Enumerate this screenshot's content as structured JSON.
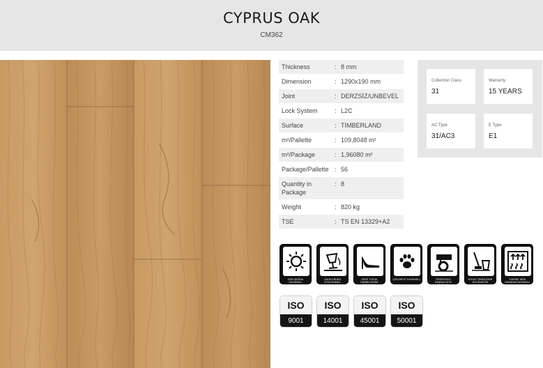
{
  "product": {
    "name": "CYPRUS OAK",
    "code": "CM362"
  },
  "specs": [
    {
      "label": "Thickness",
      "value": "8 mm"
    },
    {
      "label": "Dimension",
      "value": "1290x190 mm"
    },
    {
      "label": "Joint",
      "value": "DERZSİZ/UNBEVEL"
    },
    {
      "label": "Lock System",
      "value": "L2C"
    },
    {
      "label": "Surface",
      "value": "TIMBERLAND"
    },
    {
      "label": "m²/Pallette",
      "value": "109,8048 m²"
    },
    {
      "label": "m²/Package",
      "value": "1,96080 m²"
    },
    {
      "label": "Package/Pallette",
      "value": "56"
    },
    {
      "label": "Quantity in Package",
      "value": "8"
    },
    {
      "label": "Weight",
      "value": "820 kg"
    },
    {
      "label": "TSE",
      "value": "TS EN 13329+A2"
    }
  ],
  "spec_separator": ":",
  "info_cards": [
    {
      "label": "Collection Class",
      "value": "31"
    },
    {
      "label": "Warranty",
      "value": "15 YEARS"
    },
    {
      "label": "AC Type",
      "value": "31/AC3"
    },
    {
      "label": "E Type",
      "value": "E1"
    }
  ],
  "feature_icons": [
    {
      "icon": "sun-icon",
      "caption": "GÜN IŞIĞINA DAYANIKLI"
    },
    {
      "icon": "spill-glass-icon",
      "caption": "LEKELERDEN ETKİLENMEZ"
    },
    {
      "icon": "high-heel-icon",
      "caption": "SİVRİ TOPUK DARBELERİNE DAYANIKLI"
    },
    {
      "icon": "paw-print-icon",
      "caption": "ÇİZİLMEYE DAYANIKLI"
    },
    {
      "icon": "chair-wheel-icon",
      "caption": "TEKERLEKLİ SANDALYEYE DAYANIKLI"
    },
    {
      "icon": "mop-bucket-icon",
      "caption": "KOLAY TEMİZLENİR HİJYENİKTİR"
    },
    {
      "icon": "humidity-icon",
      "caption": "YÜKSEK NEM ORANINA DAYANIKLI"
    }
  ],
  "iso_badges": [
    {
      "label": "ISO",
      "number": "9001"
    },
    {
      "label": "ISO",
      "number": "14001"
    },
    {
      "label": "ISO",
      "number": "45001"
    },
    {
      "label": "ISO",
      "number": "50001"
    }
  ],
  "colors": {
    "header_bg": "#e6e6e6",
    "wood_base": "#c4935e",
    "badge_dark": "#151515"
  }
}
